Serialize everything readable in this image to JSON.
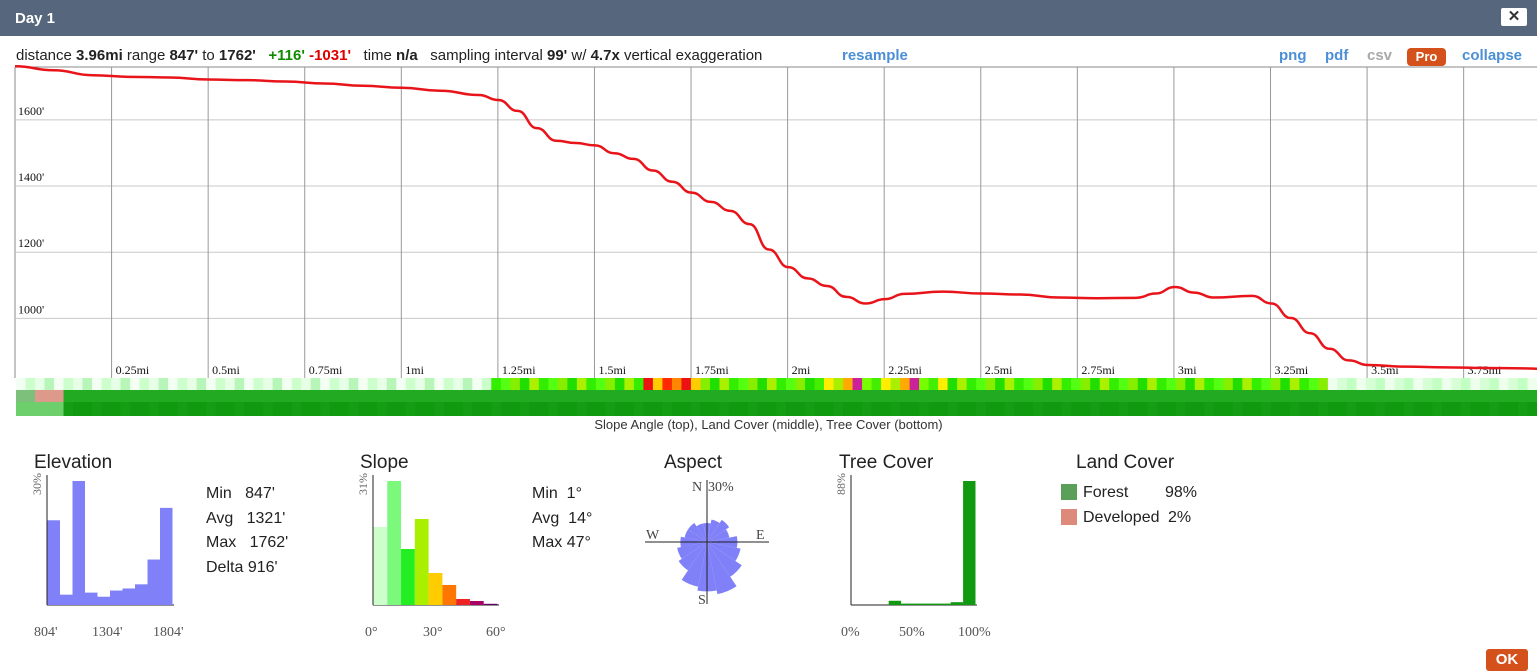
{
  "window": {
    "title": "Day 1",
    "close_glyph": "✕"
  },
  "stats": {
    "distance_label": "distance",
    "distance": "3.96mi",
    "range_label": "range",
    "range_min": "847'",
    "range_to": "to",
    "range_max": "1762'",
    "gain": "+116'",
    "loss": "-1031'",
    "time_label": "time",
    "time": "n/a",
    "sampling_label": "sampling interval",
    "sampling": "99'",
    "with_label": "w/",
    "exaggeration": "4.7x",
    "exaggeration_label": "vertical exaggeration"
  },
  "actions": {
    "resample": "resample",
    "png": "png",
    "pdf": "pdf",
    "csv": "csv",
    "pro": "Pro",
    "collapse": "collapse",
    "ok": "OK"
  },
  "colors": {
    "titlebar": "#56677d",
    "profile_line": "#e8141a",
    "link": "#4c8fd6",
    "pro": "#d4511b",
    "histogram_blue": "#8080f8",
    "forest": "#5aa05a",
    "developed": "#dd8a7a"
  },
  "profile": {
    "x_ticks": [
      "0.25mi",
      "0.5mi",
      "0.75mi",
      "1mi",
      "1.25mi",
      "1.5mi",
      "1.75mi",
      "2mi",
      "2.25mi",
      "2.5mi",
      "2.75mi",
      "3mi",
      "3.25mi",
      "3.5mi",
      "3.75mi"
    ],
    "y_ticks": [
      "1600'",
      "1400'",
      "1200'",
      "1000'"
    ]
  },
  "chart_data": [
    {
      "type": "line",
      "title": "",
      "xlabel": "",
      "ylabel": "",
      "x_unit": "mi",
      "y_unit": "ft",
      "xlim": [
        0,
        3.96
      ],
      "ylim": [
        850,
        1790
      ],
      "x": [
        0,
        0.1,
        0.2,
        0.3,
        0.4,
        0.5,
        0.6,
        0.7,
        0.8,
        0.9,
        1.0,
        1.1,
        1.2,
        1.25,
        1.3,
        1.35,
        1.4,
        1.45,
        1.5,
        1.55,
        1.6,
        1.65,
        1.7,
        1.75,
        1.8,
        1.85,
        1.9,
        1.95,
        2.0,
        2.05,
        2.1,
        2.15,
        2.2,
        2.25,
        2.3,
        2.4,
        2.5,
        2.6,
        2.7,
        2.8,
        2.9,
        2.95,
        3.0,
        3.05,
        3.1,
        3.2,
        3.25,
        3.3,
        3.35,
        3.4,
        3.45,
        3.5,
        3.6,
        3.7,
        3.8,
        3.9,
        3.96
      ],
      "y": [
        1762,
        1750,
        1735,
        1730,
        1728,
        1722,
        1720,
        1716,
        1710,
        1703,
        1697,
        1688,
        1675,
        1660,
        1627,
        1575,
        1537,
        1530,
        1523,
        1499,
        1482,
        1447,
        1413,
        1380,
        1352,
        1325,
        1285,
        1208,
        1155,
        1121,
        1098,
        1065,
        1045,
        1058,
        1074,
        1081,
        1075,
        1072,
        1063,
        1061,
        1062,
        1075,
        1095,
        1078,
        1063,
        1068,
        1045,
        1001,
        955,
        908,
        873,
        859,
        854,
        852,
        850,
        849,
        847
      ]
    },
    {
      "type": "bar",
      "title": "Elevation",
      "categories": [
        "804'",
        "",
        "",
        "",
        "",
        "",
        "",
        "",
        "",
        "",
        "",
        "1804'"
      ],
      "x_ticks": [
        "804'",
        "1304'",
        "1804'"
      ],
      "y_label": "30%",
      "y_max_percent": 30,
      "values": [
        20.5,
        2.5,
        30,
        3,
        2,
        3.5,
        4,
        5,
        11,
        23.5
      ],
      "stats": {
        "min_label": "Min",
        "min": "847'",
        "avg_label": "Avg",
        "avg": "1321'",
        "max_label": "Max",
        "max": "1762'",
        "delta_label": "Delta",
        "delta": "916'"
      }
    },
    {
      "type": "bar",
      "title": "Slope",
      "x_ticks": [
        "0°",
        "30°",
        "60°"
      ],
      "y_label": "31%",
      "y_max_percent": 31,
      "values": [
        19.5,
        31,
        14,
        21.5,
        8,
        5,
        1.5,
        1,
        0.3
      ],
      "colors": [
        "#ccffcc",
        "#7cf87c",
        "#22ee22",
        "#aaee00",
        "#ffcc00",
        "#ff7700",
        "#ee2222",
        "#aa0066",
        "#660066"
      ],
      "stats": {
        "min_label": "Min",
        "min": "1°",
        "avg_label": "Avg",
        "avg": "14°",
        "max_label": "Max",
        "max": "47°"
      }
    },
    {
      "type": "pie",
      "title": "Aspect",
      "labels": {
        "n": "N",
        "s": "S",
        "e": "E",
        "w": "W",
        "scale": "30%"
      },
      "values_percent": {
        "N": 5,
        "NNE": 6,
        "NE": 7,
        "ENE": 6,
        "E": 8,
        "ESE": 9,
        "SE": 11,
        "SSE": 14,
        "S": 13,
        "SSW": 12,
        "SW": 9,
        "WSW": 8,
        "W": 7,
        "WNW": 6,
        "NW": 6,
        "NNW": 5
      }
    },
    {
      "type": "bar",
      "title": "Tree Cover",
      "x_ticks": [
        "0%",
        "50%",
        "100%"
      ],
      "y_label": "88%",
      "y_max_percent": 88,
      "values": [
        0,
        0,
        0,
        3,
        1,
        1,
        1,
        1,
        2,
        88
      ]
    },
    {
      "type": "table",
      "title": "Land Cover",
      "rows": [
        {
          "label": "Forest",
          "value": "98%"
        },
        {
          "label": "Developed",
          "value": "2%"
        }
      ]
    }
  ],
  "strips": {
    "caption": "Slope Angle (top), Land Cover (middle), Tree Cover (bottom)"
  }
}
